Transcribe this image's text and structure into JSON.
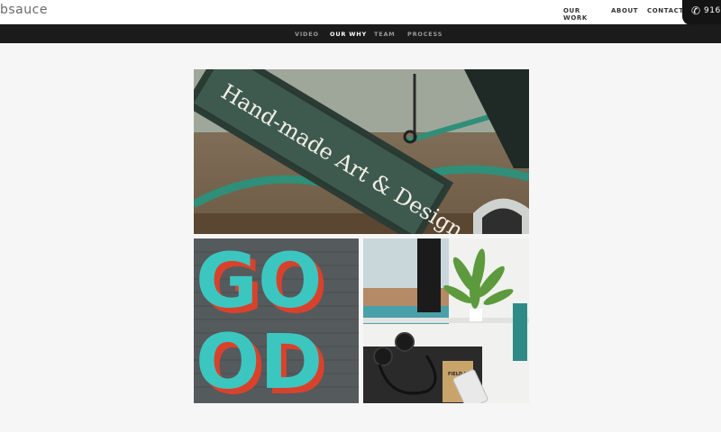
{
  "header": {
    "logo_text": "bsauce",
    "nav": [
      "OUR WORK",
      "ABOUT",
      "CONTACT"
    ],
    "phone": {
      "icon": "phone-icon",
      "text": "916"
    }
  },
  "subnav": {
    "items": [
      "VIDEO",
      "OUR WHY",
      "TEAM",
      "PROCESS"
    ],
    "active": "OUR WHY"
  },
  "gallery": {
    "sign_text_line1": "Hand-made Art & Design",
    "mural_text_top": "GO",
    "mural_text_bottom": "OD",
    "notebook_text": "FIELD NOTES",
    "colors": {
      "sign_green": "#3e5a4f",
      "mural_teal": "#3cc6c0",
      "mural_red": "#d8422c",
      "page_bg": "#f6f6f6",
      "subnav_bg": "#1b1b1b"
    }
  }
}
